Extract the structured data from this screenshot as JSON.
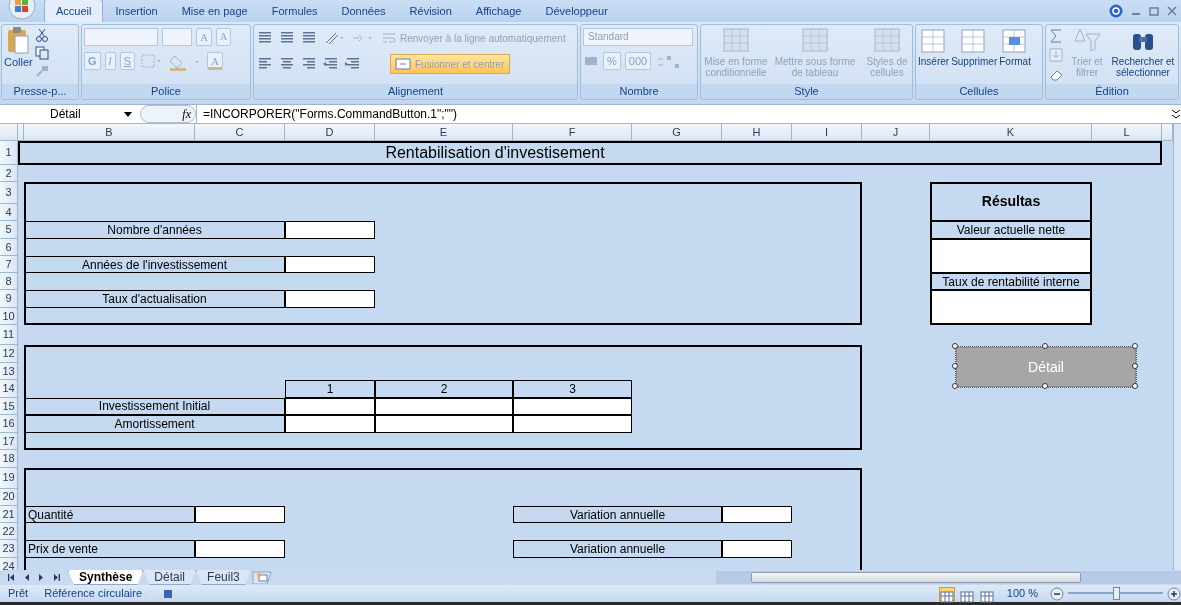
{
  "ribbon": {
    "tabs": [
      {
        "label": "Accueil",
        "selected": true
      },
      {
        "label": "Insertion",
        "selected": false
      },
      {
        "label": "Mise en page",
        "selected": false
      },
      {
        "label": "Formules",
        "selected": false
      },
      {
        "label": "Données",
        "selected": false
      },
      {
        "label": "Révision",
        "selected": false
      },
      {
        "label": "Affichage",
        "selected": false
      },
      {
        "label": "Développeur",
        "selected": false
      }
    ],
    "clipboard": {
      "label": "Presse-p...",
      "paste": {
        "label": "Coller",
        "disabled": false
      }
    },
    "font": {
      "label": "Police",
      "bold": "G",
      "italic": "I",
      "underline": "S",
      "grow": "A",
      "shrink": "A",
      "text_color": "A",
      "disabled": true
    },
    "alignment": {
      "label": "Alignement",
      "wrap": {
        "label": "Renvoyer à la ligne automatiquement",
        "disabled": true
      },
      "merge": {
        "label": "Fusionner et centrer",
        "disabled": true,
        "highlighted": true
      }
    },
    "number": {
      "label": "Nombre",
      "format": "Standard",
      "percent": "%",
      "thousands": "000",
      "disabled": true
    },
    "style": {
      "label": "Style",
      "buttons": [
        {
          "label": "Mise en forme conditionnelle",
          "disabled": true
        },
        {
          "label": "Mettre sous forme de tableau",
          "disabled": true
        },
        {
          "label": "Styles de cellules",
          "disabled": true
        }
      ]
    },
    "cells": {
      "label": "Cellules",
      "buttons": [
        {
          "label": "Insérer",
          "disabled": false
        },
        {
          "label": "Supprimer",
          "disabled": false
        },
        {
          "label": "Format",
          "disabled": false
        }
      ]
    },
    "editing": {
      "label": "Édition",
      "sort": {
        "label": "Trier et filtrer",
        "disabled": true
      },
      "find": {
        "label": "Rechercher et sélectionner",
        "disabled": false
      }
    }
  },
  "formula_bar": {
    "name_box": "Détail",
    "fx": "fx",
    "formula": "=INCORPORER(\"Forms.CommandButton.1\";\"\")"
  },
  "sheet": {
    "column_headers": [
      "B",
      "C",
      "D",
      "E",
      "F",
      "G",
      "H",
      "I",
      "J",
      "K",
      "L"
    ],
    "row_headers": [
      "1",
      "2",
      "3",
      "4",
      "5",
      "6",
      "7",
      "8",
      "9",
      "10",
      "11",
      "12",
      "13",
      "14",
      "15",
      "16",
      "17",
      "18",
      "19",
      "20",
      "21",
      "22",
      "23",
      "24"
    ],
    "title": "Rentabilisation d'investisement",
    "parameters": [
      "Nombre d'années",
      "Années de l'investissement",
      "Taux d'actualisation"
    ],
    "results": {
      "heading": "Résultas",
      "items": [
        "Valeur actuelle nette",
        "Taux de rentabilité interne"
      ]
    },
    "schedule": {
      "columns": [
        "1",
        "2",
        "3"
      ],
      "rows": [
        "Investissement Initial",
        "Amortissement"
      ]
    },
    "variables": [
      {
        "label": "Quantité",
        "variation": "Variation annuelle"
      },
      {
        "label": "Prix de vente",
        "variation": "Variation annuelle"
      }
    ],
    "button": {
      "label": "Détail",
      "selected": true
    }
  },
  "sheet_tabs": [
    {
      "label": "Synthèse",
      "selected": true
    },
    {
      "label": "Détail",
      "selected": false
    },
    {
      "label": "Feuil3",
      "selected": false
    }
  ],
  "status_bar": {
    "ready": "Prêt",
    "circular": "Référence circulaire",
    "views": [
      {
        "selected": true
      },
      {
        "selected": false
      },
      {
        "selected": false
      }
    ],
    "zoom": "100 %",
    "zoom_slider": {
      "level": 0.5
    }
  }
}
